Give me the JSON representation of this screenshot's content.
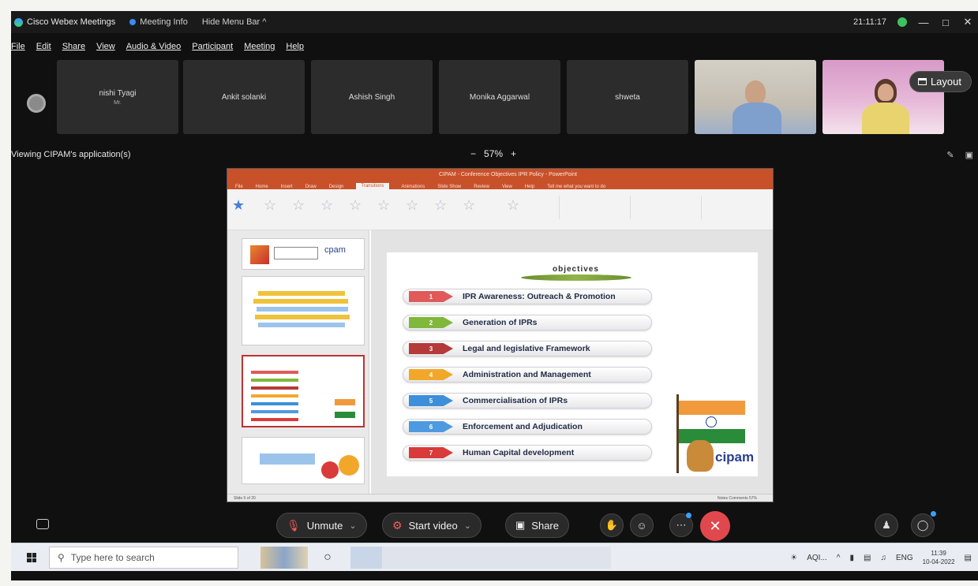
{
  "titlebar": {
    "app_name": "Cisco Webex Meetings",
    "meeting_info": "Meeting Info",
    "hide_menu": "Hide Menu Bar ^",
    "clock": "21:11:17"
  },
  "menu": [
    "File",
    "Edit",
    "Share",
    "View",
    "Audio & Video",
    "Participant",
    "Meeting",
    "Help"
  ],
  "participants": [
    {
      "name": "nishi Tyagi",
      "sub": "Mr."
    },
    {
      "name": "Ankit solanki",
      "sub": ""
    },
    {
      "name": "Ashish Singh",
      "sub": ""
    },
    {
      "name": "Monika Aggarwal",
      "sub": ""
    },
    {
      "name": "shweta",
      "sub": ""
    }
  ],
  "layout_button": "Layout",
  "viewing_label": "Viewing CIPAM's application(s)",
  "zoom": {
    "minus": "−",
    "value": "57%",
    "plus": "+"
  },
  "powerpoint": {
    "title": "CIPAM - Conference Objectives IPR Policy - PowerPoint",
    "tabs": [
      "File",
      "Home",
      "Insert",
      "Draw",
      "Design",
      "Transitions",
      "Animations",
      "Slide Show",
      "Review",
      "View",
      "Help",
      "Tell me what you want to do"
    ],
    "status_left": "Slide 5 of 20",
    "status_right": "Notes  Comments  57%"
  },
  "slide": {
    "heading": "objectives",
    "objectives": [
      {
        "num": "1",
        "label": "IPR Awareness: Outreach & Promotion",
        "color": "#e05a5a"
      },
      {
        "num": "2",
        "label": "Generation of IPRs",
        "color": "#7fb83a"
      },
      {
        "num": "3",
        "label": "Legal and legislative Framework",
        "color": "#b53a3a"
      },
      {
        "num": "4",
        "label": "Administration and Management",
        "color": "#f1a82a"
      },
      {
        "num": "5",
        "label": "Commercialisation of IPRs",
        "color": "#3d8fd9"
      },
      {
        "num": "6",
        "label": "Enforcement and Adjudication",
        "color": "#4e9ae0"
      },
      {
        "num": "7",
        "label": "Human Capital development",
        "color": "#d93a3a"
      }
    ],
    "logo_text": "cipam"
  },
  "controls": {
    "unmute": "Unmute",
    "start_video": "Start video",
    "share": "Share"
  },
  "taskbar": {
    "search_placeholder": "Type here to search",
    "lang": "ENG",
    "time": "11:39",
    "date": "10-04-2022",
    "tray_app": "AQI..."
  }
}
